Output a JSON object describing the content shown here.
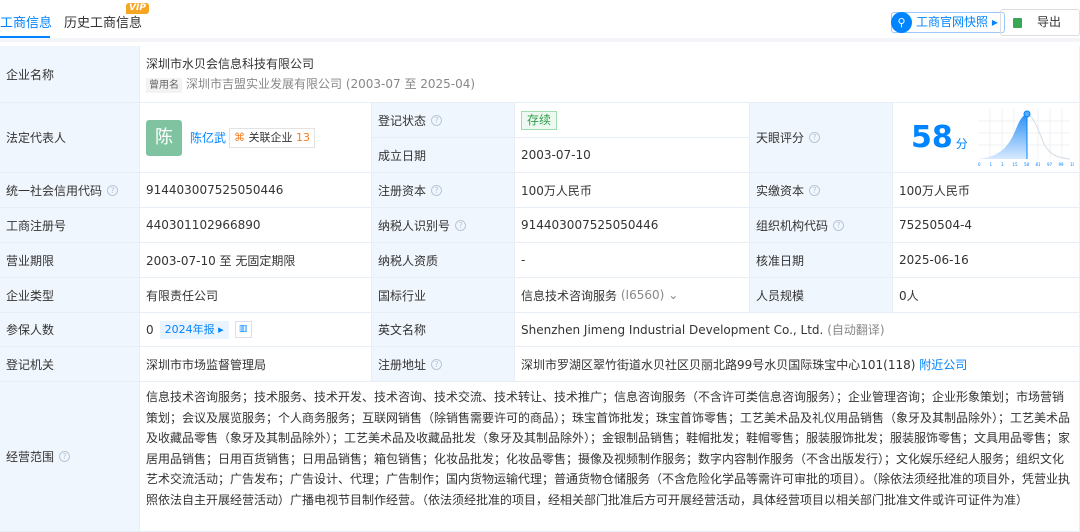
{
  "tabs": [
    {
      "label": "工商信息"
    },
    {
      "label": "历史工商信息",
      "badge": "VIP"
    }
  ],
  "header_actions": {
    "snapshot": "工商官网快照",
    "export": "导出"
  },
  "company": {
    "name_label": "企业名称",
    "name": "深圳市水贝会信息科技有限公司",
    "former_tag": "曾用名",
    "former_name": "深圳市吉盟实业发展有限公司 (2003-07 至 2025-04)",
    "legal_label": "法定代表人",
    "legal_avatar": "陈",
    "legal_name": "陈亿武",
    "assoc_label": "关联企业",
    "assoc_count": "13",
    "status_label": "登记状态",
    "status": "存续",
    "founded_label": "成立日期",
    "founded": "2003-07-10",
    "score_label": "天眼评分",
    "score": "58",
    "score_unit": "分",
    "score_axis": [
      "0",
      "1",
      "3",
      "15",
      "58",
      "81",
      "97",
      "99",
      "100"
    ],
    "credit_label": "统一社会信用代码",
    "credit": "914403007525050446",
    "reg_capital_label": "注册资本",
    "reg_capital": "100万人民币",
    "paid_capital_label": "实缴资本",
    "paid_capital": "100万人民币",
    "reg_no_label": "工商注册号",
    "reg_no": "440301102966890",
    "tax_id_label": "纳税人识别号",
    "tax_id": "914403007525050446",
    "org_code_label": "组织机构代码",
    "org_code": "75250504-4",
    "term_label": "营业期限",
    "term": "2003-07-10 至 无固定期限",
    "tax_qual_label": "纳税人资质",
    "tax_qual": "-",
    "approve_label": "核准日期",
    "approve": "2025-06-16",
    "type_label": "企业类型",
    "type": "有限责任公司",
    "industry_label": "国标行业",
    "industry": "信息技术咨询服务",
    "industry_code": "(I6560)",
    "staff_label": "人员规模",
    "staff": "0人",
    "insured_label": "参保人数",
    "insured": "0",
    "report": "2024年报",
    "en_label": "英文名称",
    "en_name": "Shenzhen Jimeng Industrial Development Co., Ltd.",
    "en_note": "(自动翻译)",
    "authority_label": "登记机关",
    "authority": "深圳市市场监督管理局",
    "address_label": "注册地址",
    "address": "深圳市罗湖区翠竹街道水贝社区贝丽北路99号水贝国际珠宝中心101(118)",
    "nearby": "附近公司",
    "scope_label": "经营范围",
    "scope": "信息技术咨询服务；技术服务、技术开发、技术咨询、技术交流、技术转让、技术推广；信息咨询服务（不含许可类信息咨询服务）；企业管理咨询；企业形象策划；市场营销策划；会议及展览服务；个人商务服务；互联网销售（除销售需要许可的商品）；珠宝首饰批发；珠宝首饰零售；工艺美术品及礼仪用品销售（象牙及其制品除外）；工艺美术品及收藏品零售（象牙及其制品除外）；工艺美术品及收藏品批发（象牙及其制品除外）；金银制品销售；鞋帽批发；鞋帽零售；服装服饰批发；服装服饰零售；文具用品零售；家居用品销售；日用百货销售；日用品销售；箱包销售；化妆品批发；化妆品零售；摄像及视频制作服务；数字内容制作服务（不含出版发行）；文化娱乐经纪人服务；组织文化艺术交流活动；广告发布；广告设计、代理；广告制作；国内货物运输代理；普通货物仓储服务（不含危险化学品等需许可审批的项目）。（除依法须经批准的项目外，凭营业执照依法自主开展经营活动）广播电视节目制作经营。（依法须经批准的项目，经相关部门批准后方可开展经营活动，具体经营项目以相关部门批准文件或许可证件为准）"
  },
  "colors": {
    "accent": "#0084ff",
    "label_bg": "#f0f6fd",
    "status_green": "#2e9e4a"
  }
}
